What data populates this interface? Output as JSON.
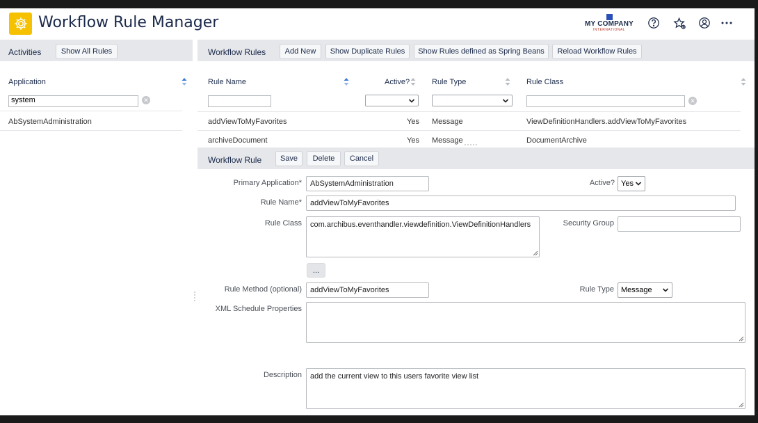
{
  "app": {
    "title": "Workflow Rule Manager",
    "company_name": "MY COMPANY",
    "company_sub": "INTERNATIONAL"
  },
  "top_icons": [
    "help-icon",
    "favorites-star-icon",
    "user-icon",
    "more-icon"
  ],
  "activities": {
    "title": "Activities",
    "show_all_label": "Show All Rules",
    "column": "Application",
    "filter_value": "system",
    "rows": [
      "AbSystemAdministration"
    ]
  },
  "rules": {
    "title": "Workflow Rules",
    "buttons": {
      "add_new": "Add New",
      "show_duplicates": "Show Duplicate Rules",
      "show_spring": "Show Rules defined as Spring Beans",
      "reload": "Reload Workflow Rules"
    },
    "columns": {
      "rule_name": "Rule Name",
      "active": "Active?",
      "rule_type": "Rule Type",
      "rule_class": "Rule Class"
    },
    "rows": [
      {
        "rule_name": "addViewToMyFavorites",
        "active": "Yes",
        "rule_type": "Message",
        "rule_class": "ViewDefinitionHandlers.addViewToMyFavorites"
      },
      {
        "rule_name": "archiveDocument",
        "active": "Yes",
        "rule_type": "Message",
        "rule_class": "DocumentArchive"
      }
    ]
  },
  "form": {
    "title": "Workflow Rule",
    "buttons": {
      "save": "Save",
      "delete": "Delete",
      "cancel": "Cancel",
      "ellipsis": "..."
    },
    "labels": {
      "primary_application": "Primary Application",
      "rule_name": "Rule Name",
      "rule_class": "Rule Class",
      "rule_method": "Rule Method (optional)",
      "xml_schedule": "XML Schedule Properties",
      "description": "Description",
      "active": "Active?",
      "security_group": "Security Group",
      "rule_type": "Rule Type",
      "required_mark": "*"
    },
    "values": {
      "primary_application": "AbSystemAdministration",
      "rule_name": "addViewToMyFavorites",
      "rule_class": "com.archibus.eventhandler.viewdefinition.ViewDefinitionHandlers",
      "rule_method": "addViewToMyFavorites",
      "xml_schedule": "",
      "description": "add the current view to this users favorite view list",
      "active": "Yes",
      "security_group": "",
      "rule_type": "Message"
    }
  },
  "colors": {
    "accent": "#f5c100",
    "panel_header": "#e5e7ea",
    "title_text": "#1b2a4a",
    "sort_arrow": "#3a7bd5"
  }
}
